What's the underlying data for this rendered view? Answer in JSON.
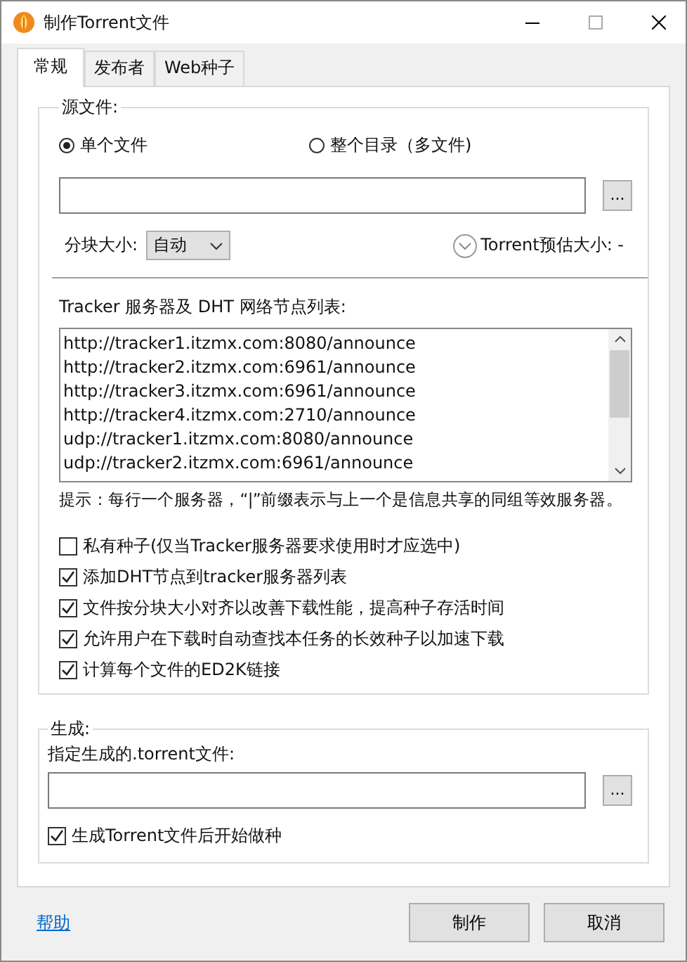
{
  "window": {
    "title": "制作Torrent文件"
  },
  "tabs": [
    {
      "label": "常规",
      "selected": true
    },
    {
      "label": "发布者",
      "selected": false
    },
    {
      "label": "Web种子",
      "selected": false
    }
  ],
  "source": {
    "legend": "源文件:",
    "modes": [
      {
        "label": "单个文件",
        "selected": true
      },
      {
        "label": "整个目录（多文件)",
        "selected": false
      }
    ],
    "browse_button": "...",
    "piece_size": {
      "label": "分块大小:",
      "value": "自动"
    },
    "estimate": {
      "label": "Torrent预估大小: -"
    },
    "tracker_label": "Tracker 服务器及 DHT 网络节点列表:",
    "trackers": [
      "http://tracker1.itzmx.com:8080/announce",
      "http://tracker2.itzmx.com:6961/announce",
      "http://tracker3.itzmx.com:6961/announce",
      "http://tracker4.itzmx.com:2710/announce",
      "udp://tracker1.itzmx.com:8080/announce",
      "udp://tracker2.itzmx.com:6961/announce"
    ],
    "hint": "提示：每行一个服务器，“|”前缀表示与上一个是信息共享的同组等效服务器。",
    "options": [
      {
        "label": "私有种子(仅当Tracker服务器要求使用时才应选中)",
        "checked": false
      },
      {
        "label": "添加DHT节点到tracker服务器列表",
        "checked": true
      },
      {
        "label": "文件按分块大小对齐以改善下载性能，提高种子存活时间",
        "checked": true
      },
      {
        "label": "允许用户在下载时自动查找本任务的长效种子以加速下载",
        "checked": true
      },
      {
        "label": "计算每个文件的ED2K链接",
        "checked": true
      }
    ]
  },
  "output": {
    "legend": "生成:",
    "file_label": "指定生成的.torrent文件:",
    "browse_button": "...",
    "seed_option": {
      "label": "生成Torrent文件后开始做种",
      "checked": true
    }
  },
  "help_link": "帮助",
  "buttons": [
    "制作",
    "取消"
  ]
}
